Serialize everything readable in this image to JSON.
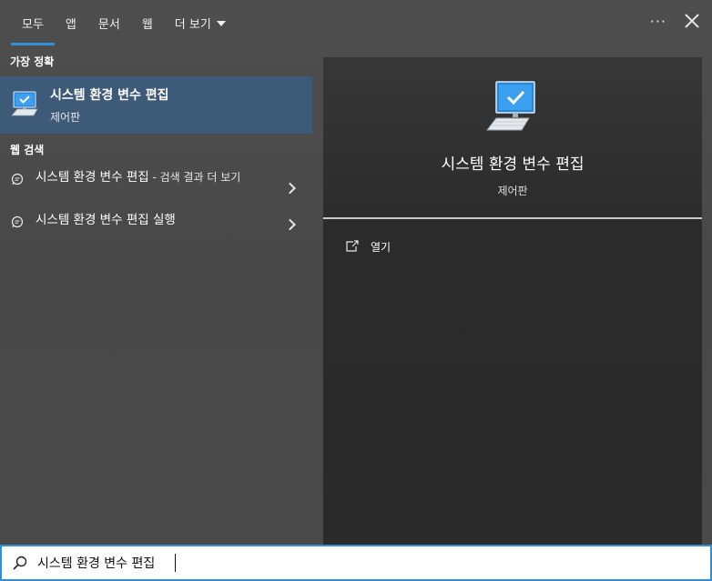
{
  "tabs": [
    {
      "label": "모두",
      "active": true
    },
    {
      "label": "앱",
      "active": false
    },
    {
      "label": "문서",
      "active": false
    },
    {
      "label": "웹",
      "active": false
    },
    {
      "label": "더 보기",
      "active": false
    }
  ],
  "top_actions": {
    "more_icon": "ellipsis-icon",
    "close_icon": "close-icon"
  },
  "left": {
    "best_match_heading": "가장 정확",
    "best_match": {
      "title": "시스템 환경 변수 편집",
      "subtitle": "제어판",
      "icon": "monitor-check-icon"
    },
    "web_heading": "웹 검색",
    "web_results": [
      {
        "text": "시스템 환경 변수 편집",
        "suffix": " - 검색 결과 더 보기",
        "icon": "chat-bubble-icon"
      },
      {
        "text": "시스템 환경 변수 편집 실행",
        "suffix": "",
        "icon": "chat-bubble-icon"
      }
    ]
  },
  "detail": {
    "title": "시스템 환경 변수 편집",
    "subtitle": "제어판",
    "actions": [
      {
        "label": "열기",
        "icon": "open-window-icon"
      }
    ]
  },
  "search": {
    "value": "시스템 환경 변수 편집",
    "placeholder": ""
  },
  "colors": {
    "accent": "#2f8fd8",
    "selected_row": "#3d5a78",
    "detail_bg": "#2b2b2b"
  }
}
